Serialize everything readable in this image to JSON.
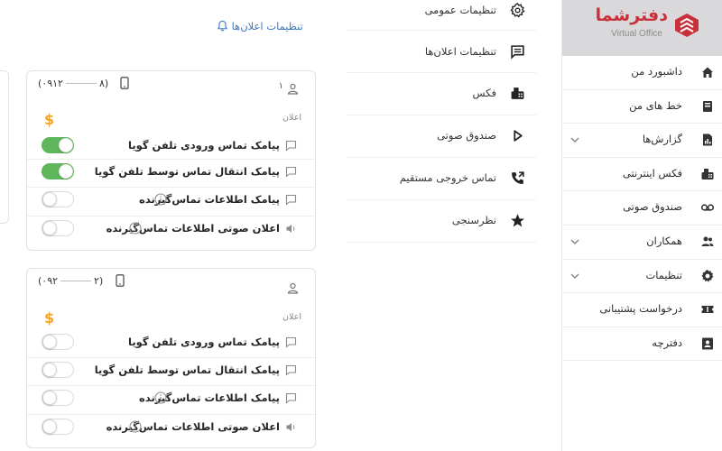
{
  "brand": {
    "name": "دفترشما",
    "sub": "Virtual Office",
    "color": "#c8313a"
  },
  "sidebar": {
    "items": [
      {
        "label": "داشبورد من",
        "icon": "home-icon",
        "expandable": false
      },
      {
        "label": "خط های من",
        "icon": "book-icon",
        "expandable": false
      },
      {
        "label": "گزارش‌ها",
        "icon": "report-icon",
        "expandable": true
      },
      {
        "label": "فکس اینترنتی",
        "icon": "fax-icon",
        "expandable": false
      },
      {
        "label": "صندوق صوتی",
        "icon": "voicemail-icon",
        "expandable": false
      },
      {
        "label": "همکاران",
        "icon": "people-icon",
        "expandable": true
      },
      {
        "label": "تنظیمات",
        "icon": "gear-icon",
        "expandable": true
      },
      {
        "label": "درخواست پشتیبانی",
        "icon": "ticket-icon",
        "expandable": false
      },
      {
        "label": "دفترچه",
        "icon": "contact-book-icon",
        "expandable": false
      }
    ]
  },
  "settings_menu": {
    "items": [
      {
        "label": "تنظیمات عمومی",
        "icon": "gear-icon"
      },
      {
        "label": "تنظیمات اعلان‌ها",
        "icon": "message-icon"
      },
      {
        "label": "فکس",
        "icon": "fax-icon"
      },
      {
        "label": "صندوق صوتی",
        "icon": "play-icon"
      },
      {
        "label": "تماس خروجی مستقیم",
        "icon": "outgoing-call-icon"
      },
      {
        "label": "نظرسنجی",
        "icon": "star-icon"
      }
    ]
  },
  "header": {
    "title": "تنظیمات اعلان‌ها",
    "accent": "#3b78c4"
  },
  "cards": [
    {
      "number_start": "(۰۹۱۲",
      "number_end": "۸)",
      "extension": "۱",
      "section_label": "اعلان",
      "rows": [
        {
          "label": "پیامک تماس ورودی تلفن گویا",
          "icon": "sms-icon",
          "on": true,
          "info": false
        },
        {
          "label": "پیامک انتقال تماس توسط تلفن گویا",
          "icon": "sms-icon",
          "on": true,
          "info": false
        },
        {
          "label": "پیامک اطلاعات تماس‌گیرنده",
          "icon": "sms-icon",
          "on": false,
          "info": true
        },
        {
          "label": "اعلان صوتی اطلاعات تماس‌گیرنده",
          "icon": "speaker-icon",
          "on": false,
          "info": true
        }
      ]
    },
    {
      "number_start": "(۰۹۲",
      "number_end": "۲)",
      "extension": "",
      "section_label": "اعلان",
      "rows": [
        {
          "label": "پیامک تماس ورودی تلفن گویا",
          "icon": "sms-icon",
          "on": false,
          "info": false
        },
        {
          "label": "پیامک انتقال تماس توسط تلفن گویا",
          "icon": "sms-icon",
          "on": false,
          "info": false
        },
        {
          "label": "پیامک اطلاعات تماس‌گیرنده",
          "icon": "sms-icon",
          "on": false,
          "info": true
        },
        {
          "label": "اعلان صوتی اطلاعات تماس‌گیرنده",
          "icon": "speaker-icon",
          "on": false,
          "info": true
        }
      ]
    }
  ],
  "colors": {
    "toggle_on": "#5fb65a",
    "dollar": "#f2a62c"
  }
}
